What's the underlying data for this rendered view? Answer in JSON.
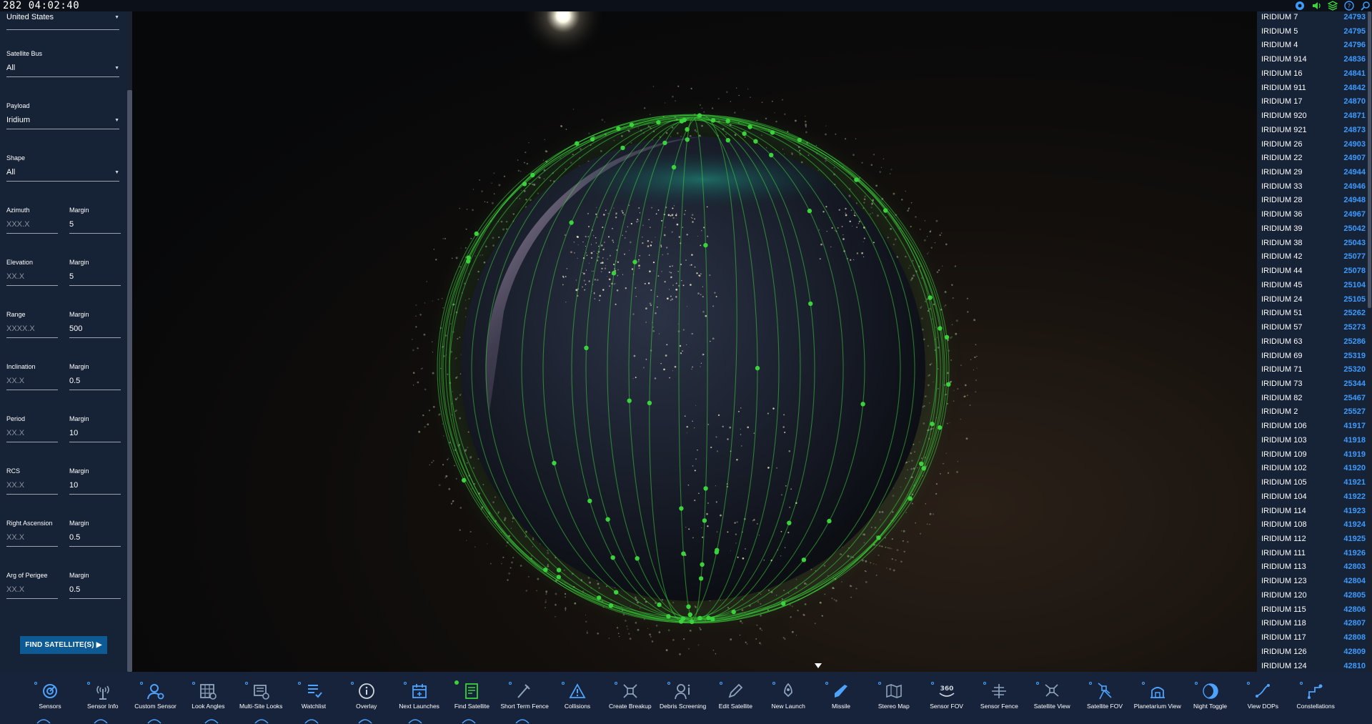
{
  "topbar": {
    "clock": "282 04:02:40",
    "icons": [
      "github-icon",
      "volume-icon",
      "layers-icon",
      "help-icon",
      "search-icon"
    ]
  },
  "filters": {
    "country": {
      "value": "United States"
    },
    "satellite_bus": {
      "label": "Satellite Bus",
      "value": "All"
    },
    "payload": {
      "label": "Payload",
      "value": "Iridium"
    },
    "shape": {
      "label": "Shape",
      "value": "All"
    },
    "azimuth": {
      "label": "Azimuth",
      "placeholder": "XXX.X",
      "margin_label": "Margin",
      "margin": "5"
    },
    "elevation": {
      "label": "Elevation",
      "placeholder": "XX.X",
      "margin_label": "Margin",
      "margin": "5"
    },
    "range": {
      "label": "Range",
      "placeholder": "XXXX.X",
      "margin_label": "Margin",
      "margin": "500"
    },
    "inclination": {
      "label": "Inclination",
      "placeholder": "XX.X",
      "margin_label": "Margin",
      "margin": "0.5"
    },
    "period": {
      "label": "Period",
      "placeholder": "XX.X",
      "margin_label": "Margin",
      "margin": "10"
    },
    "rcs": {
      "label": "RCS",
      "placeholder": "XX.X",
      "margin_label": "Margin",
      "margin": "10"
    },
    "right_ascension": {
      "label": "Right Ascension",
      "placeholder": "XX.X",
      "margin_label": "Margin",
      "margin": "0.5"
    },
    "arg_of_perigee": {
      "label": "Arg of Perigee",
      "placeholder": "XX.X",
      "margin_label": "Margin",
      "margin": "0.5"
    },
    "find_button": "FIND SATELLITE(S) ▶"
  },
  "results": [
    {
      "name": "IRIDIUM 7",
      "id": "24793"
    },
    {
      "name": "IRIDIUM 5",
      "id": "24795"
    },
    {
      "name": "IRIDIUM 4",
      "id": "24796"
    },
    {
      "name": "IRIDIUM 914",
      "id": "24836"
    },
    {
      "name": "IRIDIUM 16",
      "id": "24841"
    },
    {
      "name": "IRIDIUM 911",
      "id": "24842"
    },
    {
      "name": "IRIDIUM 17",
      "id": "24870"
    },
    {
      "name": "IRIDIUM 920",
      "id": "24871"
    },
    {
      "name": "IRIDIUM 921",
      "id": "24873"
    },
    {
      "name": "IRIDIUM 26",
      "id": "24903"
    },
    {
      "name": "IRIDIUM 22",
      "id": "24907"
    },
    {
      "name": "IRIDIUM 29",
      "id": "24944"
    },
    {
      "name": "IRIDIUM 33",
      "id": "24946"
    },
    {
      "name": "IRIDIUM 28",
      "id": "24948"
    },
    {
      "name": "IRIDIUM 36",
      "id": "24967"
    },
    {
      "name": "IRIDIUM 39",
      "id": "25042"
    },
    {
      "name": "IRIDIUM 38",
      "id": "25043"
    },
    {
      "name": "IRIDIUM 42",
      "id": "25077"
    },
    {
      "name": "IRIDIUM 44",
      "id": "25078"
    },
    {
      "name": "IRIDIUM 45",
      "id": "25104"
    },
    {
      "name": "IRIDIUM 24",
      "id": "25105"
    },
    {
      "name": "IRIDIUM 51",
      "id": "25262"
    },
    {
      "name": "IRIDIUM 57",
      "id": "25273"
    },
    {
      "name": "IRIDIUM 63",
      "id": "25286"
    },
    {
      "name": "IRIDIUM 69",
      "id": "25319"
    },
    {
      "name": "IRIDIUM 71",
      "id": "25320"
    },
    {
      "name": "IRIDIUM 73",
      "id": "25344"
    },
    {
      "name": "IRIDIUM 82",
      "id": "25467"
    },
    {
      "name": "IRIDIUM 2",
      "id": "25527"
    },
    {
      "name": "IRIDIUM 106",
      "id": "41917"
    },
    {
      "name": "IRIDIUM 103",
      "id": "41918"
    },
    {
      "name": "IRIDIUM 109",
      "id": "41919"
    },
    {
      "name": "IRIDIUM 102",
      "id": "41920"
    },
    {
      "name": "IRIDIUM 105",
      "id": "41921"
    },
    {
      "name": "IRIDIUM 104",
      "id": "41922"
    },
    {
      "name": "IRIDIUM 114",
      "id": "41923"
    },
    {
      "name": "IRIDIUM 108",
      "id": "41924"
    },
    {
      "name": "IRIDIUM 112",
      "id": "41925"
    },
    {
      "name": "IRIDIUM 111",
      "id": "41926"
    },
    {
      "name": "IRIDIUM 113",
      "id": "42803"
    },
    {
      "name": "IRIDIUM 123",
      "id": "42804"
    },
    {
      "name": "IRIDIUM 120",
      "id": "42805"
    },
    {
      "name": "IRIDIUM 115",
      "id": "42806"
    },
    {
      "name": "IRIDIUM 118",
      "id": "42807"
    },
    {
      "name": "IRIDIUM 117",
      "id": "42808"
    },
    {
      "name": "IRIDIUM 126",
      "id": "42809"
    },
    {
      "name": "IRIDIUM 124",
      "id": "42810"
    }
  ],
  "toolbar": [
    {
      "label": "Sensors",
      "icon": "sensors-icon"
    },
    {
      "label": "Sensor Info",
      "icon": "sensor-info-icon"
    },
    {
      "label": "Custom Sensor",
      "icon": "custom-sensor-icon"
    },
    {
      "label": "Look Angles",
      "icon": "look-angles-icon"
    },
    {
      "label": "Multi-Site Looks",
      "icon": "multi-site-looks-icon"
    },
    {
      "label": "Watchlist",
      "icon": "watchlist-icon"
    },
    {
      "label": "Overlay",
      "icon": "overlay-icon"
    },
    {
      "label": "Next Launches",
      "icon": "next-launches-icon"
    },
    {
      "label": "Find Satellite",
      "icon": "find-satellite-icon",
      "active": true
    },
    {
      "label": "Short Term Fence",
      "icon": "short-term-fence-icon"
    },
    {
      "label": "Collisions",
      "icon": "collisions-icon"
    },
    {
      "label": "Create Breakup",
      "icon": "create-breakup-icon"
    },
    {
      "label": "Debris Screening",
      "icon": "debris-screening-icon"
    },
    {
      "label": "Edit Satellite",
      "icon": "edit-satellite-icon"
    },
    {
      "label": "New Launch",
      "icon": "new-launch-icon"
    },
    {
      "label": "Missile",
      "icon": "missile-icon"
    },
    {
      "label": "Stereo Map",
      "icon": "stereo-map-icon"
    },
    {
      "label": "Sensor FOV",
      "icon": "sensor-fov-icon"
    },
    {
      "label": "Sensor Fence",
      "icon": "sensor-fence-icon"
    },
    {
      "label": "Satellite View",
      "icon": "satellite-view-icon"
    },
    {
      "label": "Satellite FOV",
      "icon": "satellite-fov-icon"
    },
    {
      "label": "Planetarium View",
      "icon": "planetarium-view-icon"
    },
    {
      "label": "Night Toggle",
      "icon": "night-toggle-icon"
    },
    {
      "label": "View DOPs",
      "icon": "view-dops-icon"
    },
    {
      "label": "Constellations",
      "icon": "constellations-icon"
    }
  ],
  "colors": {
    "panel": "#162236",
    "toolbar": "#17233a",
    "accent": "#3d9bff",
    "orbit": "#3bd33b",
    "button": "#0d5a94"
  }
}
